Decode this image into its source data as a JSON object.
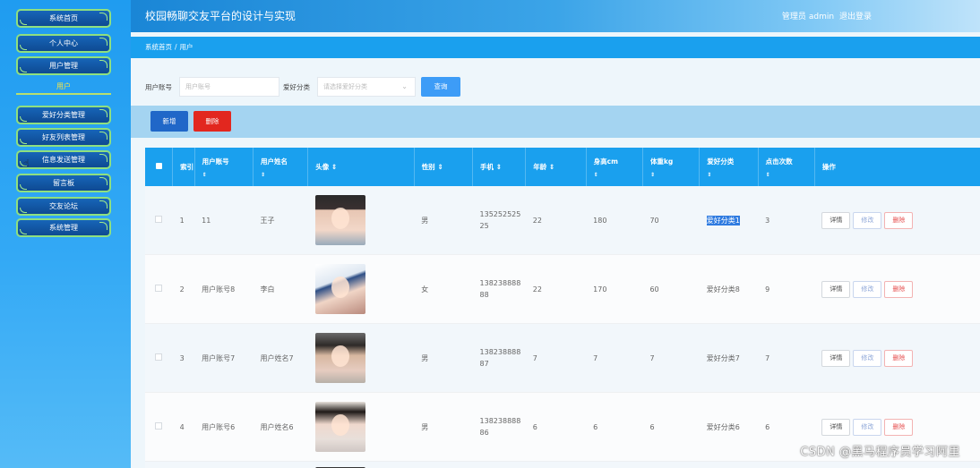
{
  "app": {
    "title": "校园畅聊交友平台的设计与实现"
  },
  "user": {
    "role_label": "管理员",
    "name": "admin",
    "logout": "退出登录"
  },
  "sidebar": {
    "items": [
      {
        "label": "系统首页"
      },
      {
        "label": "个人中心"
      },
      {
        "label": "用户管理"
      },
      {
        "label": "爱好分类管理"
      },
      {
        "label": "好友列表管理"
      },
      {
        "label": "信息发送管理"
      },
      {
        "label": "留言板"
      },
      {
        "label": "交友论坛"
      },
      {
        "label": "系统管理"
      }
    ],
    "active_sub": "用户"
  },
  "breadcrumb": {
    "home": "系统首页",
    "sep": "/",
    "current": "用户"
  },
  "search": {
    "account_label": "用户账号",
    "account_placeholder": "用户账号",
    "category_label": "爱好分类",
    "category_placeholder": "请选择爱好分类",
    "query_button": "查询"
  },
  "actions": {
    "add": "新增",
    "delete": "删除"
  },
  "table": {
    "columns": [
      "索引",
      "用户账号",
      "用户姓名",
      "头像",
      "性别",
      "手机",
      "年龄",
      "身高cm",
      "体重kg",
      "爱好分类",
      "点击次数",
      "操作"
    ],
    "sort_glyph": "⇕",
    "row_actions": {
      "detail": "详情",
      "edit": "修改",
      "delete": "删除"
    },
    "rows": [
      {
        "index": "1",
        "account": "11",
        "name": "王子",
        "avatar": "av1",
        "gender": "男",
        "phone": "13525252525",
        "age": "22",
        "height": "180",
        "weight": "70",
        "category": "爱好分类1",
        "clicks": "3",
        "highlight": true
      },
      {
        "index": "2",
        "account": "用户账号8",
        "name": "李白",
        "avatar": "av2",
        "gender": "女",
        "phone": "13823888888",
        "age": "22",
        "height": "170",
        "weight": "60",
        "category": "爱好分类8",
        "clicks": "9",
        "highlight": false
      },
      {
        "index": "3",
        "account": "用户账号7",
        "name": "用户姓名7",
        "avatar": "av3",
        "gender": "男",
        "phone": "13823888887",
        "age": "7",
        "height": "7",
        "weight": "7",
        "category": "爱好分类7",
        "clicks": "7",
        "highlight": false
      },
      {
        "index": "4",
        "account": "用户账号6",
        "name": "用户姓名6",
        "avatar": "av4",
        "gender": "男",
        "phone": "13823888886",
        "age": "6",
        "height": "6",
        "weight": "6",
        "category": "爱好分类6",
        "clicks": "6",
        "highlight": false
      }
    ]
  },
  "watermark": "CSDN @黑马程序员学习阿里"
}
